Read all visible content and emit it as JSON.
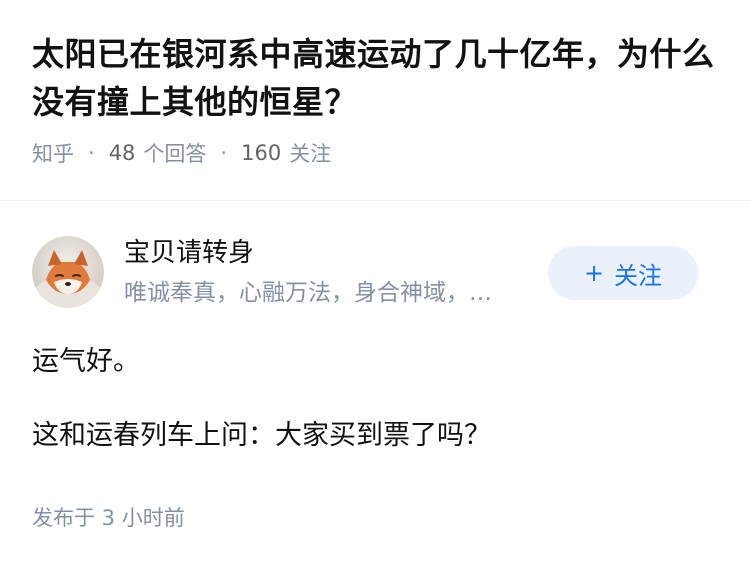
{
  "question": {
    "title": "太阳已在银河系中高速运动了几十亿年，为什么没有撞上其他的恒星？",
    "source": "知乎",
    "separator": "·",
    "answer_count": "48",
    "answer_label": "个回答",
    "follower_count": "160",
    "follower_label": "关注"
  },
  "answer": {
    "author": {
      "name": "宝贝请转身",
      "bio": "唯诚奉真，心融万法，身合神域，…",
      "avatar_icon": "fox-avatar"
    },
    "follow_button": {
      "icon": "plus-icon",
      "plus": "+",
      "label": "关注"
    },
    "paragraphs": [
      "运气好。",
      "这和运春列车上问：大家买到票了吗？"
    ],
    "published": "发布于 3 小时前"
  },
  "colors": {
    "accent": "#1772f6",
    "button_bg": "#ebf1fb",
    "meta_text": "#8590a6",
    "body_text": "#121212"
  }
}
